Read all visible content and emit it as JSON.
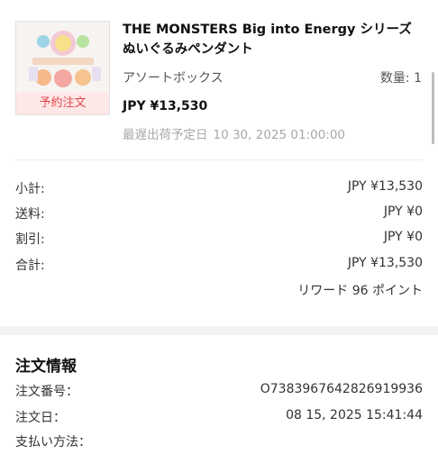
{
  "product": {
    "badge": "予約注文",
    "title": "THE MONSTERS Big into Energy シリーズ ぬいぐるみペンダント",
    "variant": "アソートボックス",
    "quantity": "数量: 1",
    "price": "JPY ¥13,530",
    "ship_label": "最遅出荷予定日",
    "ship_date": "10 30, 2025 01:00:00"
  },
  "summary": {
    "subtotal_label": "小計:",
    "subtotal_value": "JPY ¥13,530",
    "shipping_label": "送料:",
    "shipping_value": "JPY ¥0",
    "discount_label": "割引:",
    "discount_value": "JPY ¥0",
    "total_label": "合計:",
    "total_value": "JPY ¥13,530",
    "reward": "リワード 96 ポイント"
  },
  "order_info": {
    "title": "注文情報",
    "number_label": "注文番号：",
    "number_value": "O7383967642826919936",
    "date_label": "注文日：",
    "date_value": "08 15, 2025 15:41:44",
    "payment_label": "支払い方法："
  }
}
